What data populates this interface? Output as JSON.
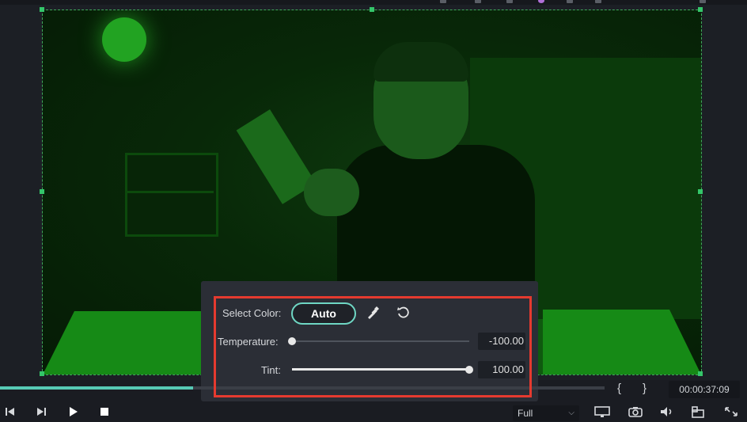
{
  "preview": {
    "timecode": "00:00:37:09",
    "progress": 0.32,
    "in_mark": "{",
    "out_mark": "}",
    "quality": "Full"
  },
  "color_panel": {
    "select_color_label": "Select Color:",
    "auto_label": "Auto",
    "temperature_label": "Temperature:",
    "temperature_value": "-100.00",
    "temperature_level": 0.0,
    "tint_label": "Tint:",
    "tint_value": "100.00",
    "tint_level": 1.0
  },
  "colors": {
    "accent": "#57c9b4",
    "highlight": "#e53a2f",
    "selection": "#34c66a"
  },
  "icons": {
    "eyedropper": "eyedropper-icon",
    "reset": "reset-icon",
    "playback": [
      "step-back-icon",
      "step-forward-icon",
      "play-icon",
      "stop-icon"
    ],
    "right": [
      "monitor-icon",
      "camera-icon",
      "volume-icon",
      "layout-icon",
      "fullscreen-icon"
    ]
  }
}
